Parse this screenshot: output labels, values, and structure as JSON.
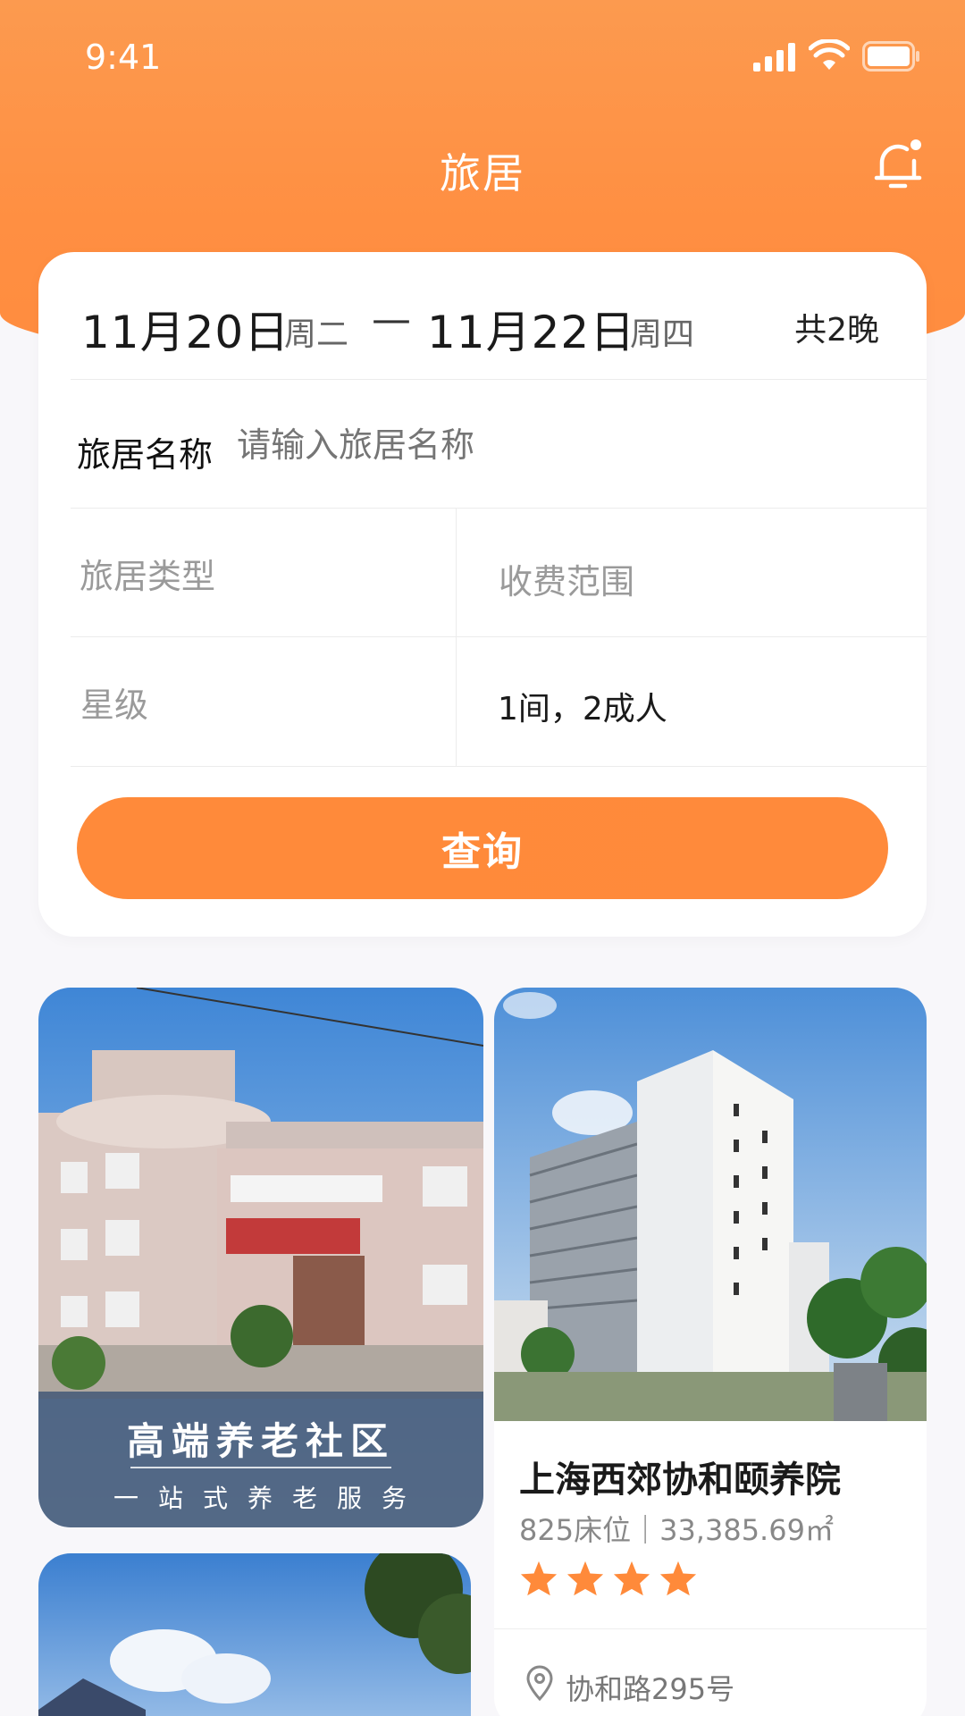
{
  "status_bar": {
    "time": "9:41"
  },
  "nav": {
    "title": "旅居"
  },
  "search": {
    "check_in_date": "11月20日",
    "check_in_week": "周二",
    "dash": "—",
    "check_out_date": "11月22日",
    "check_out_week": "周四",
    "nights": "共2晚",
    "name_label": "旅居名称",
    "name_placeholder": "请输入旅居名称",
    "type_placeholder": "旅居类型",
    "price_placeholder": "收费范围",
    "star_placeholder": "星级",
    "guests_value": "1间，2成人",
    "query_button": "查询"
  },
  "promo": {
    "title": "高端养老社区",
    "subtitle": "一站式养老服务"
  },
  "listing": {
    "name": "上海西郊协和颐养院",
    "meta": "825床位｜33,385.69㎡",
    "star_rating": 4,
    "address": "协和路295号"
  },
  "colors": {
    "accent": "#ff8a3a",
    "star": "#ff8a3a"
  }
}
